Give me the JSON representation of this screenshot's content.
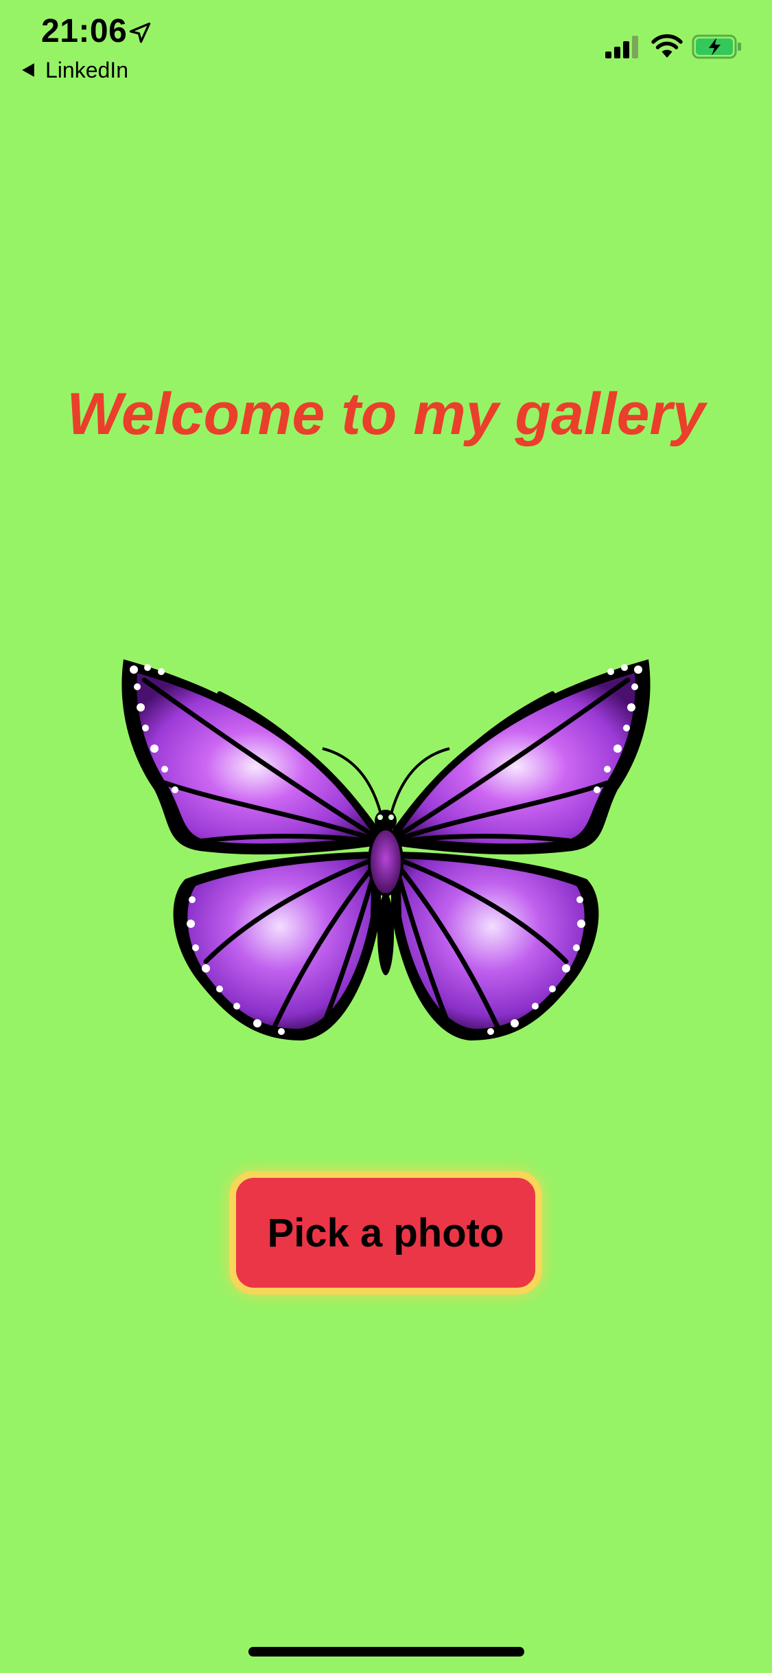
{
  "status_bar": {
    "time": "21:06",
    "back_app": "LinkedIn",
    "icons": [
      "location-arrow-icon",
      "cellular-signal-icon",
      "wifi-icon",
      "battery-charging-icon"
    ],
    "battery_color": "#34c759"
  },
  "main": {
    "title": "Welcome to my gallery",
    "title_color": "#ea3f2b",
    "image": "butterfly-image",
    "button_label": "Pick a photo",
    "button_color": "#eb3647",
    "button_border_color": "#f7d65a"
  },
  "background_color": "#97f366"
}
